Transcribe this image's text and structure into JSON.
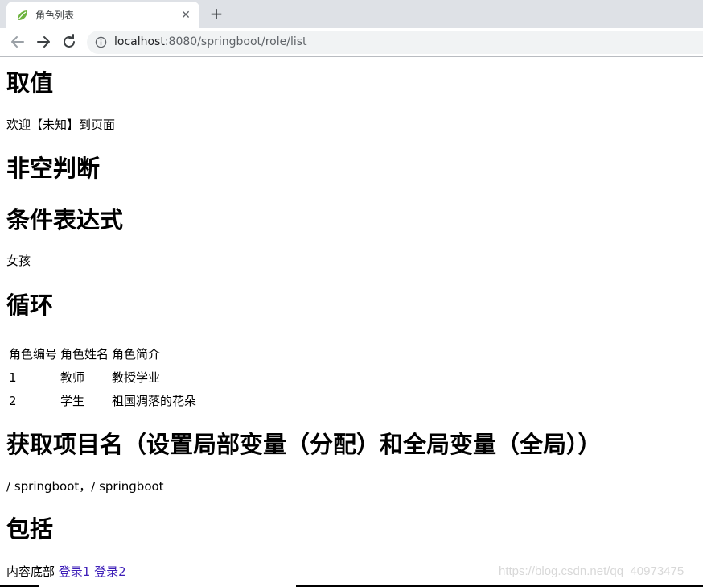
{
  "browser": {
    "tab": {
      "title": "角色列表",
      "favicon": "spring-leaf-icon"
    },
    "new_tab": "+",
    "close": "✕",
    "url": {
      "host": "localhost",
      "rest": ":8080/springboot/role/list"
    }
  },
  "page": {
    "sections": {
      "value_title": "取值",
      "welcome": "欢迎【未知】到页面",
      "nonempty_title": "非空判断",
      "conditional_title": "条件表达式",
      "gender": "女孩",
      "loop_title": "循环",
      "project_title": "获取项目名（设置局部变量（分配）和全局变量（全局））",
      "project_path": "/ springboot，/ springboot",
      "include_title": "包括",
      "footer_text": "内容底部",
      "login1": "登录1",
      "login2": "登录2"
    },
    "table": {
      "headers": [
        "角色编号",
        "角色姓名",
        "角色简介"
      ],
      "rows": [
        [
          "1",
          "教师",
          "教授学业"
        ],
        [
          "2",
          "学生",
          "祖国凋落的花朵"
        ]
      ]
    },
    "watermark": "https://blog.csdn.net/qq_40973475"
  },
  "colors": {
    "tabstrip": "#dee1e6",
    "omnibox": "#f1f3f4",
    "link": "#3e1fb8"
  }
}
